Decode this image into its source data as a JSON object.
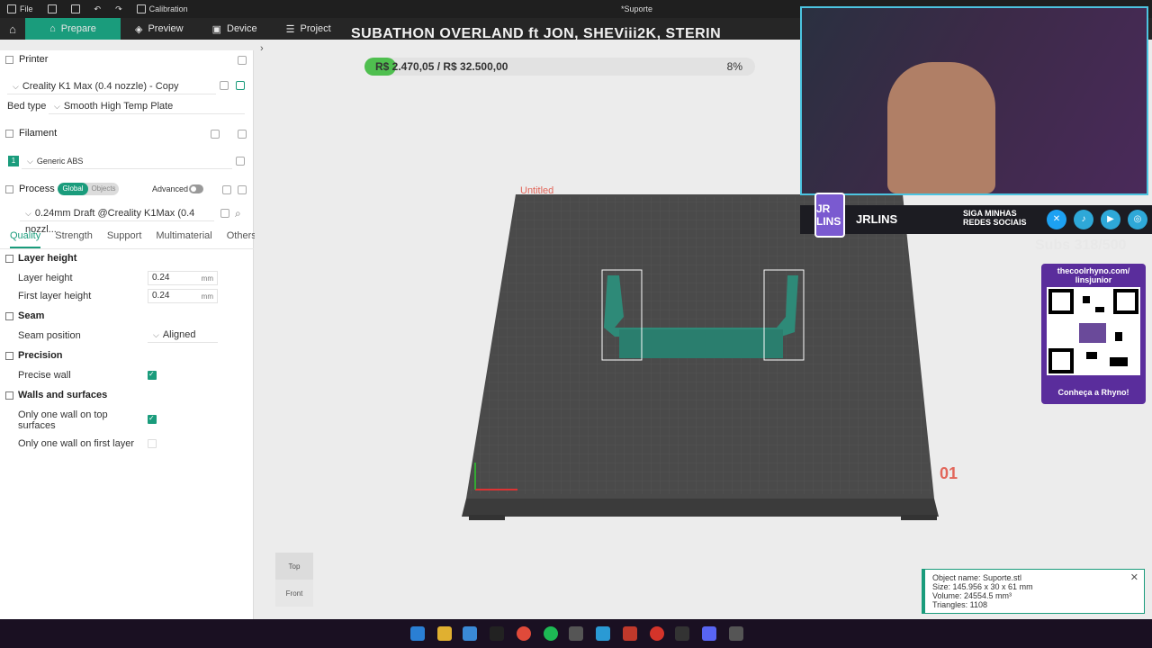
{
  "titlebar": {
    "file_label": "File",
    "calibration_label": "Calibration",
    "doc_title": "*Suporte"
  },
  "tabs": [
    {
      "label": "Prepare"
    },
    {
      "label": "Preview"
    },
    {
      "label": "Device"
    },
    {
      "label": "Project"
    }
  ],
  "stream_title": "SUBATHON OVERLAND ft JON, SHEViii2K, STERIN",
  "printer": {
    "section": "Printer",
    "name": "Creality K1 Max (0.4 nozzle) - Copy",
    "bed_type_label": "Bed type",
    "bed_type": "Smooth High Temp Plate"
  },
  "filament": {
    "section": "Filament",
    "slot": "1",
    "name": "Generic ABS"
  },
  "process": {
    "section": "Process",
    "global": "Global",
    "objects": "Objects",
    "advanced": "Advanced",
    "preset": "0.24mm Draft @Creality K1Max (0.4 nozzl..."
  },
  "quality_tabs": [
    "Quality",
    "Strength",
    "Support",
    "Multimaterial",
    "Others"
  ],
  "settings": {
    "layer_height_group": "Layer height",
    "layer_height_label": "Layer height",
    "layer_height_value": "0.24",
    "first_layer_height_label": "First layer height",
    "first_layer_height_value": "0.24",
    "unit": "mm",
    "seam_group": "Seam",
    "seam_position_label": "Seam position",
    "seam_position_value": "Aligned",
    "precision_group": "Precision",
    "precise_wall_label": "Precise wall",
    "walls_group": "Walls and surfaces",
    "one_wall_top_label": "Only one wall on top surfaces",
    "one_wall_first_label": "Only one wall on first layer"
  },
  "progress": {
    "text": "R$ 2.470,05 / R$ 32.500,00",
    "percent_label": "8%",
    "value": 0.08
  },
  "viewport": {
    "plate_label": "Untitled",
    "plate_number": "01"
  },
  "view_cube": {
    "top": "Top",
    "front": "Front"
  },
  "overlay": {
    "logo": "JR LINS",
    "name": "JRLINS",
    "social": "SIGA MINHAS REDES SOCIAIS",
    "subs": "Subs 318/500",
    "qr_title": "thecoolrhyno.com/ linsjunior",
    "qr_footer": "Conheça a Rhyno!"
  },
  "object_info": {
    "name": "Object name: Suporte.stl",
    "size": "Size: 145.956 x 30 x 61 mm",
    "volume": "Volume: 24554.5 mm³",
    "triangles": "Triangles: 1108"
  },
  "colors": {
    "accent": "#1a9c7c",
    "progress_fill": "#4fbf4f",
    "plate": "#4a4a4a"
  }
}
